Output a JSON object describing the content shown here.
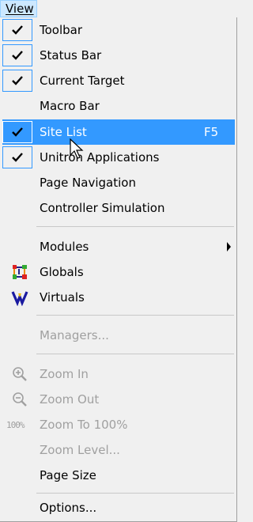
{
  "menubar": {
    "view_label": "View"
  },
  "items": {
    "toolbar": "Toolbar",
    "status_bar": "Status Bar",
    "current_target": "Current Target",
    "macro_bar": "Macro Bar",
    "site_list": "Site List",
    "site_list_shortcut": "F5",
    "unitron_applications": "Unitron Applications",
    "page_navigation": "Page Navigation",
    "controller_simulation": "Controller Simulation",
    "modules": "Modules",
    "globals": "Globals",
    "virtuals": "Virtuals",
    "managers": "Managers...",
    "zoom_in": "Zoom In",
    "zoom_out": "Zoom Out",
    "zoom_to_100": "Zoom To 100%",
    "zoom_level": "Zoom Level...",
    "page_size": "Page Size",
    "options": "Options..."
  },
  "icons": {
    "check": "checkmark-icon",
    "globals": "globals-icon",
    "virtuals": "virtuals-icon",
    "zoom_in": "zoom-in-icon",
    "zoom_out": "zoom-out-icon",
    "zoom_100": "zoom-100-icon",
    "submenu": "submenu-arrow-icon"
  },
  "zoom_100_badge": "100%",
  "colors": {
    "highlight": "#3399ff",
    "disabled_text": "#a0a0a0",
    "menubar_active": "#cce8ff"
  }
}
